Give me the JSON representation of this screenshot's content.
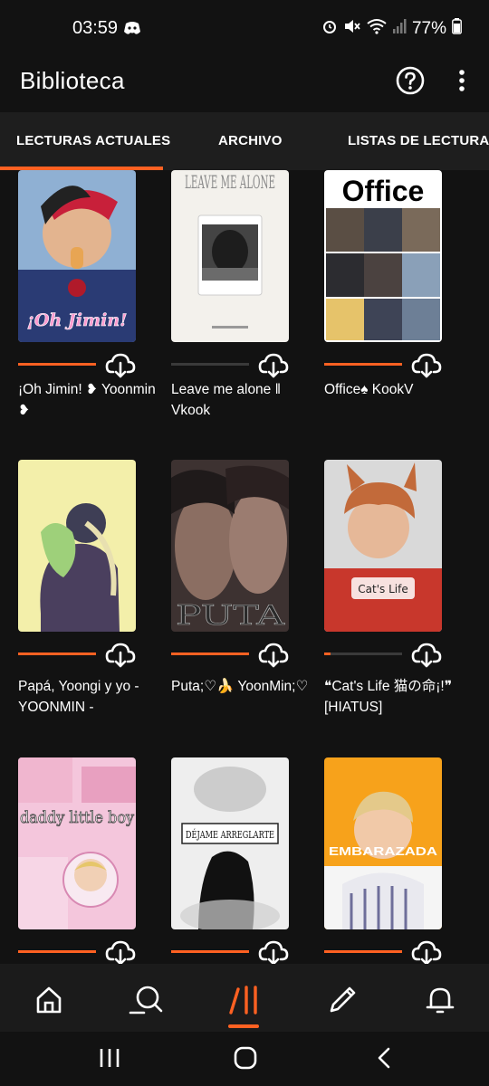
{
  "status_bar": {
    "time": "03:59",
    "battery": "77%"
  },
  "app_bar": {
    "title": "Biblioteca",
    "help_icon": "help-circle-icon",
    "more_icon": "more-vertical-icon"
  },
  "tabs": [
    {
      "label": "LECTURAS ACTUALES",
      "active": true
    },
    {
      "label": "ARCHIVO",
      "active": false
    },
    {
      "label": "LISTAS DE LECTURA",
      "active": false
    }
  ],
  "stories": [
    {
      "title": "¡Oh Jimin! ❥ Yoonmin ❥",
      "cover_text": "¡Oh Jimin!",
      "progress": 1.0,
      "cover_colors": [
        "#6b8fb5",
        "#2c3f78"
      ]
    },
    {
      "title": "Leave me alone ‖ Vkook",
      "cover_text": "LEAVE ME ALONE",
      "progress": 0.0,
      "cover_colors": [
        "#f3f1ec",
        "#1d1d1d"
      ]
    },
    {
      "title": "Office♠ KookV",
      "cover_text": "Office",
      "progress": 1.0,
      "cover_colors": [
        "#ffffff",
        "#3a3530"
      ]
    },
    {
      "title": "Papá, Yoongi y yo - YOONMIN -",
      "cover_text": "",
      "progress": 1.0,
      "cover_colors": [
        "#f3efaa",
        "#4a3f5e"
      ]
    },
    {
      "title": "Puta;♡🍌 YoonMin;♡",
      "cover_text": "PUTA",
      "progress": 1.0,
      "cover_colors": [
        "#5b4644",
        "#1f1a1a"
      ]
    },
    {
      "title": "❝Cat's Life 猫の命¡!❞ [HIATUS]",
      "cover_text": "Cat's Life",
      "progress": 0.08,
      "cover_colors": [
        "#d9d9d9",
        "#c8372c"
      ]
    },
    {
      "title": "",
      "cover_text": "daddy little boy",
      "progress": 1.0,
      "cover_colors": [
        "#f4c6dc",
        "#e8a0c0"
      ]
    },
    {
      "title": "",
      "cover_text": "DÉJAME ARREGLARTE",
      "progress": 1.0,
      "cover_colors": [
        "#eeeeee",
        "#111111"
      ]
    },
    {
      "title": "",
      "cover_text": "EMBARAZADA",
      "progress": 1.0,
      "cover_colors": [
        "#f7a21b",
        "#f5f5f5"
      ]
    }
  ],
  "bottom_nav": [
    {
      "name": "home-icon",
      "active": false
    },
    {
      "name": "discover-icon",
      "active": false
    },
    {
      "name": "library-icon",
      "active": true
    },
    {
      "name": "write-icon",
      "active": false
    },
    {
      "name": "notifications-icon",
      "active": false
    }
  ],
  "accent_color": "#ff6122"
}
